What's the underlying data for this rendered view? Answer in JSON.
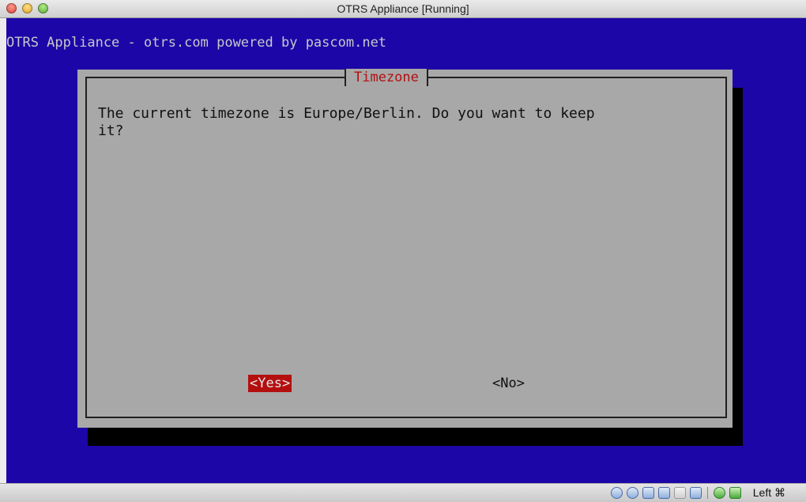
{
  "window": {
    "title": "OTRS Appliance [Running]"
  },
  "console": {
    "backtitle": "OTRS Appliance - otrs.com powered by pascom.net",
    "dialog": {
      "title": "Timezone",
      "message": "The current timezone is Europe/Berlin. Do you want to keep\nit?",
      "buttons": {
        "yes": "<Yes>",
        "no": "<No>"
      }
    },
    "colors": {
      "background": "#1d06a8",
      "dialog": "#a8a8a8",
      "accent": "#b40f0f"
    }
  },
  "statusbar": {
    "icons": [
      "hard-disk-icon",
      "optical-drive-icon",
      "usb-icon",
      "network-icon",
      "shared-folder-icon",
      "display-icon",
      "capture-icon",
      "mouse-integration-icon"
    ],
    "host_key": "Left ⌘"
  }
}
